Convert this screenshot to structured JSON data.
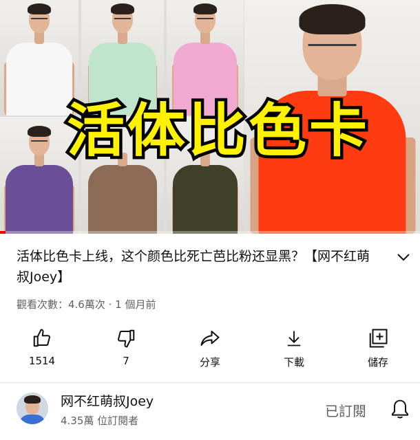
{
  "thumbnail": {
    "overlay_text": "活体比色卡",
    "shirt_colors": {
      "white": "#f7f7f7",
      "mint": "#bfe5cc",
      "pink": "#f0a9cf",
      "purple": "#6a4f97",
      "brown": "#8b6a56",
      "olive": "#3f4029",
      "red_orange": "#ff3b12"
    },
    "progress_fraction": 0.013,
    "accent_color": "#ff0000"
  },
  "video": {
    "title": "活体比色卡上线，这个颜色比死亡芭比粉还显黑？【网不红萌叔Joey】",
    "meta": "觀看次數：4.6萬次 · 1 個月前"
  },
  "actions": {
    "like": {
      "label": "1514",
      "icon": "thumbs-up-icon"
    },
    "dislike": {
      "label": "7",
      "icon": "thumbs-down-icon"
    },
    "share": {
      "label": "分享",
      "icon": "share-icon"
    },
    "download": {
      "label": "下載",
      "icon": "download-icon"
    },
    "save": {
      "label": "儲存",
      "icon": "add-to-playlist-icon"
    }
  },
  "channel": {
    "name": "网不红萌叔Joey",
    "subscribers": "4.35萬 位訂閱者",
    "subscribed_label": "已訂閱",
    "bell_icon": "bell-icon"
  }
}
